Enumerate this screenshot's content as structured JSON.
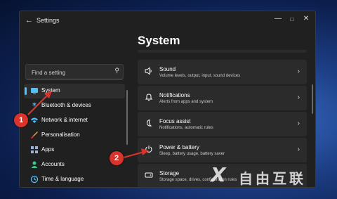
{
  "window": {
    "title": "Settings"
  },
  "page_title": "System",
  "search": {
    "placeholder": "Find a setting"
  },
  "nav": [
    {
      "label": "System",
      "icon": "display-icon",
      "active": true
    },
    {
      "label": "Bluetooth & devices",
      "icon": "bluetooth-icon"
    },
    {
      "label": "Network & internet",
      "icon": "wifi-icon"
    },
    {
      "label": "Personalisation",
      "icon": "brush-icon"
    },
    {
      "label": "Apps",
      "icon": "apps-icon"
    },
    {
      "label": "Accounts",
      "icon": "person-icon"
    },
    {
      "label": "Time & language",
      "icon": "globe-clock-icon"
    }
  ],
  "cards": [
    {
      "title": "Sound",
      "subtitle": "Volume levels, output, input, sound devices",
      "icon": "speaker-icon"
    },
    {
      "title": "Notifications",
      "subtitle": "Alerts from apps and system",
      "icon": "bell-icon"
    },
    {
      "title": "Focus assist",
      "subtitle": "Notifications, automatic rules",
      "icon": "moon-icon"
    },
    {
      "title": "Power & battery",
      "subtitle": "Sleep, battery usage, battery saver",
      "icon": "power-icon"
    },
    {
      "title": "Storage",
      "subtitle": "Storage space, drives, configuration rules",
      "icon": "storage-icon"
    }
  ],
  "annotations": {
    "badge1": "1",
    "badge2": "2",
    "arrow_color": "#d8342c"
  },
  "watermark": {
    "mark": "X",
    "text": "自由互联"
  },
  "colors": {
    "accent": "#4cc2ff",
    "window_bg": "#202020",
    "card_bg": "#2b2b2b"
  }
}
